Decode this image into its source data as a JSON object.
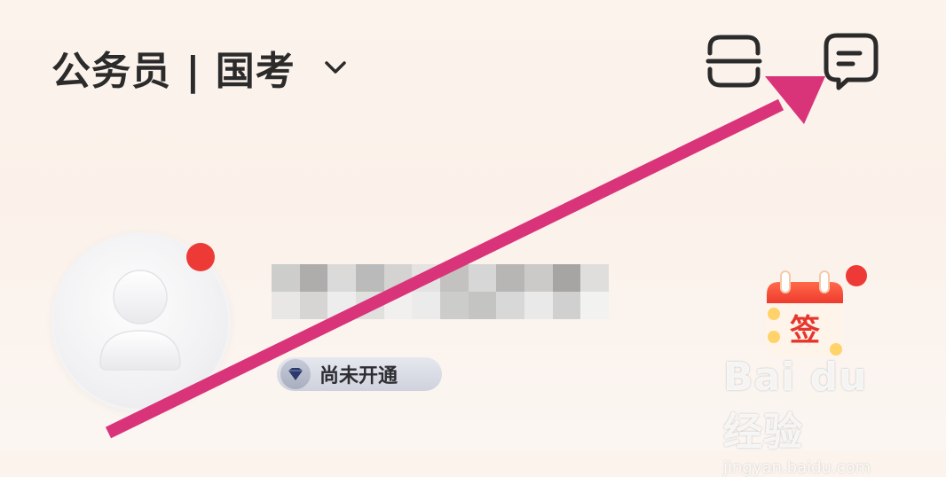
{
  "header": {
    "title": "公务员 | 国考"
  },
  "vip": {
    "status_label": "尚未开通"
  },
  "signin": {
    "label": "签"
  },
  "watermark": {
    "brand": "Bai du 经验",
    "url": "jingyan.baidu.com"
  },
  "colors": {
    "accent_red": "#ee3a36",
    "arrow_pink": "#d9347a",
    "text_dark": "#2b2b2b"
  },
  "icons": {
    "title_dropdown": "chevron-down-icon",
    "scan": "scan-icon",
    "message": "message-icon",
    "avatar": "user-avatar-icon",
    "vip": "gem-icon",
    "signin": "calendar-icon"
  }
}
